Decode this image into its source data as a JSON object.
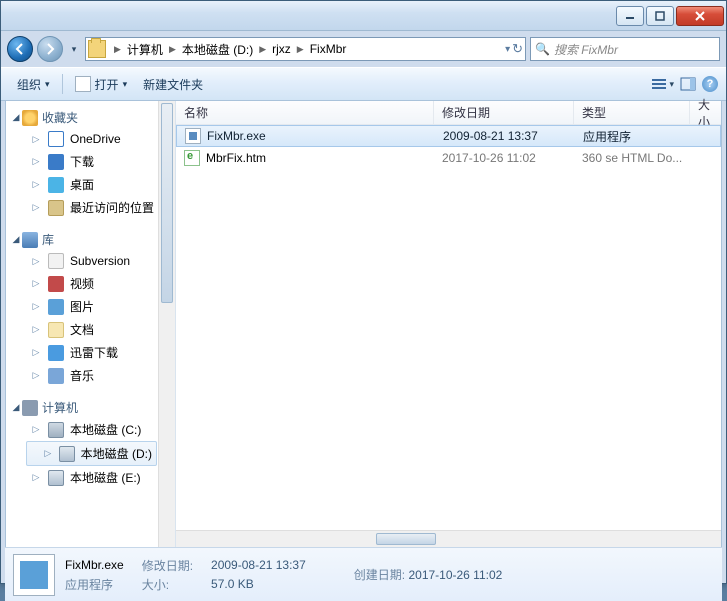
{
  "breadcrumb": {
    "segments": [
      "计算机",
      "本地磁盘 (D:)",
      "rjxz",
      "FixMbr"
    ]
  },
  "search": {
    "placeholder": "搜索 FixMbr"
  },
  "toolbar": {
    "organize": "组织",
    "open": "打开",
    "newfolder": "新建文件夹"
  },
  "columns": {
    "name": "名称",
    "date": "修改日期",
    "type": "类型",
    "size": "大小"
  },
  "files": [
    {
      "name": "FixMbr.exe",
      "date": "2009-08-21 13:37",
      "type": "应用程序",
      "icon": "exe",
      "selected": true
    },
    {
      "name": "MbrFix.htm",
      "date": "2017-10-26 11:02",
      "type": "360 se HTML Do...",
      "icon": "htm",
      "selected": false
    }
  ],
  "nav": {
    "favorites": {
      "label": "收藏夹",
      "items": [
        {
          "label": "OneDrive",
          "icon": "cloud"
        },
        {
          "label": "下载",
          "icon": "dl"
        },
        {
          "label": "桌面",
          "icon": "desk"
        },
        {
          "label": "最近访问的位置",
          "icon": "recent"
        }
      ]
    },
    "libraries": {
      "label": "库",
      "items": [
        {
          "label": "Subversion",
          "icon": "svn"
        },
        {
          "label": "视频",
          "icon": "vid"
        },
        {
          "label": "图片",
          "icon": "img"
        },
        {
          "label": "文档",
          "icon": "doc"
        },
        {
          "label": "迅雷下载",
          "icon": "xl"
        },
        {
          "label": "音乐",
          "icon": "mus"
        }
      ]
    },
    "computer": {
      "label": "计算机",
      "items": [
        {
          "label": "本地磁盘 (C:)",
          "icon": "drvc"
        },
        {
          "label": "本地磁盘 (D:)",
          "icon": "drvd",
          "selected": true
        },
        {
          "label": "本地磁盘 (E:)",
          "icon": "drvd"
        }
      ]
    }
  },
  "status": {
    "filename": "FixMbr.exe",
    "filedesc": "应用程序",
    "modlabel": "修改日期:",
    "modval": "2009-08-21 13:37",
    "sizelabel": "大小:",
    "sizeval": "57.0 KB",
    "createdlabel": "创建日期:",
    "createdval": "2017-10-26 11:02"
  }
}
